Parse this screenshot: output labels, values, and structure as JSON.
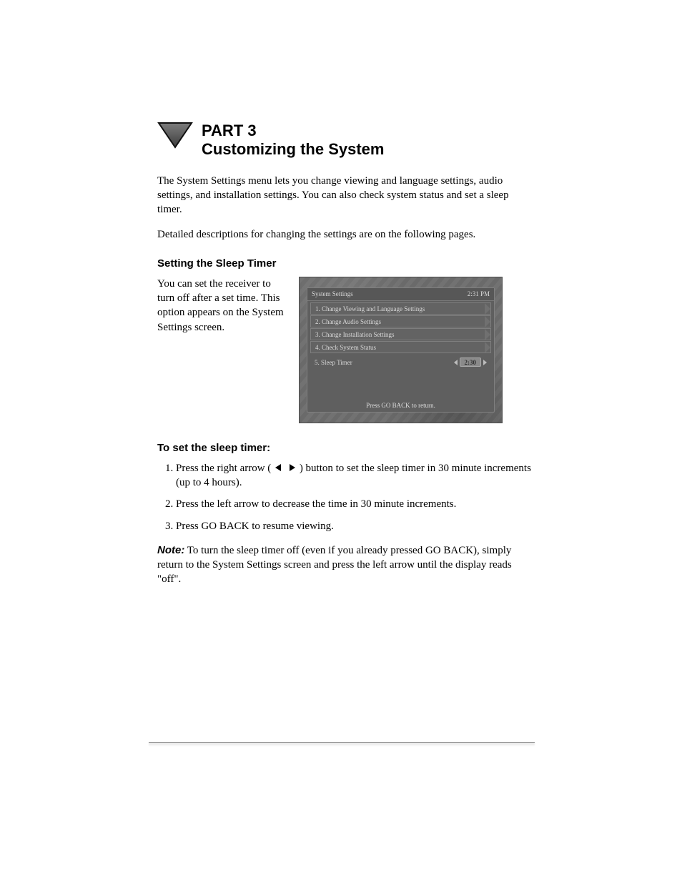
{
  "section": {
    "title_line1": "PART 3",
    "title_line2": "Customizing the System"
  },
  "intro": {
    "p1": "The System Settings menu lets you change viewing and language settings, audio settings, and installation settings. You can also check system status and set a sleep timer.",
    "p2": "Detailed descriptions for changing the settings are on the following pages."
  },
  "sleep": {
    "heading": "Setting the Sleep Timer",
    "blurb": "You can set the receiver to turn off after a set time. This option appears on the System Settings screen."
  },
  "menu": {
    "title": "System Settings",
    "clock": "2:31 PM",
    "items": [
      "1.  Change Viewing and Language Settings",
      "2.  Change Audio Settings",
      "3.  Change Installation Settings",
      "4.  Check System Status"
    ],
    "sleep_label": "5.  Sleep Timer",
    "sleep_value": "2:30",
    "footer": "Press GO BACK to return."
  },
  "steps": {
    "heading": "To set the sleep timer:",
    "s1a": "Press the right arrow (",
    "s1b": ") button to set the sleep timer in 30 minute increments (up to 4 hours).",
    "s2": "Press the left arrow to decrease the time in 30 minute increments.",
    "s3": "Press GO BACK to resume viewing."
  },
  "note": {
    "label": "Note:",
    "text": " To turn the sleep timer off (even if you already pressed GO BACK), simply return to the System Settings screen and press the left arrow until the display reads \"off\"."
  }
}
